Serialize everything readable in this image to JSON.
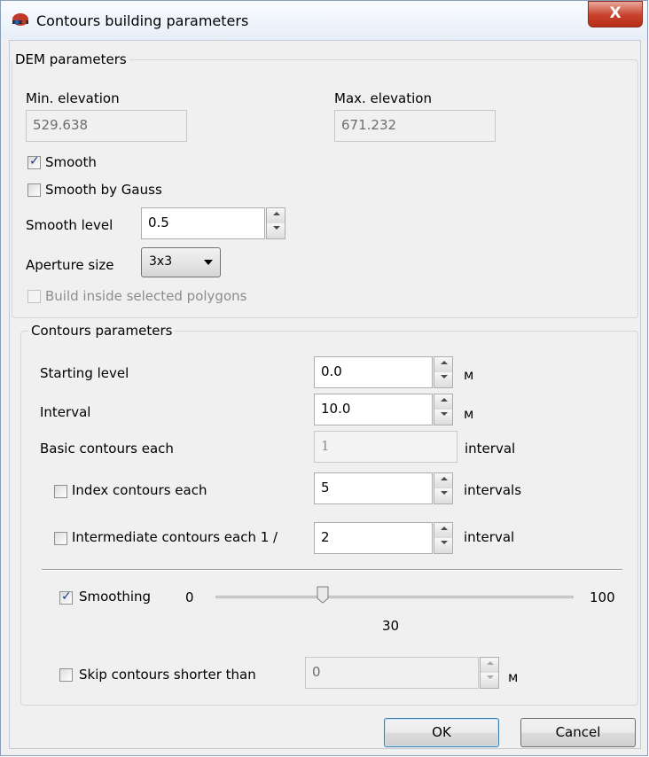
{
  "window": {
    "title": "Contours building parameters",
    "close_label": "X"
  },
  "dem": {
    "group_label": "DEM parameters",
    "min_elev_label": "Min. elevation",
    "min_elev_value": "529.638",
    "max_elev_label": "Max. elevation",
    "max_elev_value": "671.232",
    "smooth_label": "Smooth",
    "smooth_checked": true,
    "gauss_label": "Smooth by Gauss",
    "gauss_checked": false,
    "smooth_level_label": "Smooth level",
    "smooth_level_value": "0.5",
    "aperture_label": "Aperture size",
    "aperture_value": "3x3",
    "build_inside_label": "Build inside selected polygons",
    "build_inside_checked": false
  },
  "contours": {
    "group_label": "Contours parameters",
    "starting_label": "Starting level",
    "starting_value": "0.0",
    "starting_unit": "м",
    "interval_label": "Interval",
    "interval_value": "10.0",
    "interval_unit": "м",
    "basic_label": "Basic contours each",
    "basic_value": "1",
    "basic_unit": "interval",
    "index_label": "Index contours each",
    "index_checked": false,
    "index_value": "5",
    "index_unit": "intervals",
    "intermediate_label": "Intermediate contours each 1 /",
    "intermediate_checked": false,
    "intermediate_value": "2",
    "intermediate_unit": "interval",
    "smoothing_label": "Smoothing",
    "smoothing_checked": true,
    "slider_min": "0",
    "slider_max": "100",
    "slider_value": "30",
    "skip_label": "Skip contours shorter than",
    "skip_checked": false,
    "skip_value": "0",
    "skip_unit": "м"
  },
  "buttons": {
    "ok": "OK",
    "cancel": "Cancel"
  }
}
